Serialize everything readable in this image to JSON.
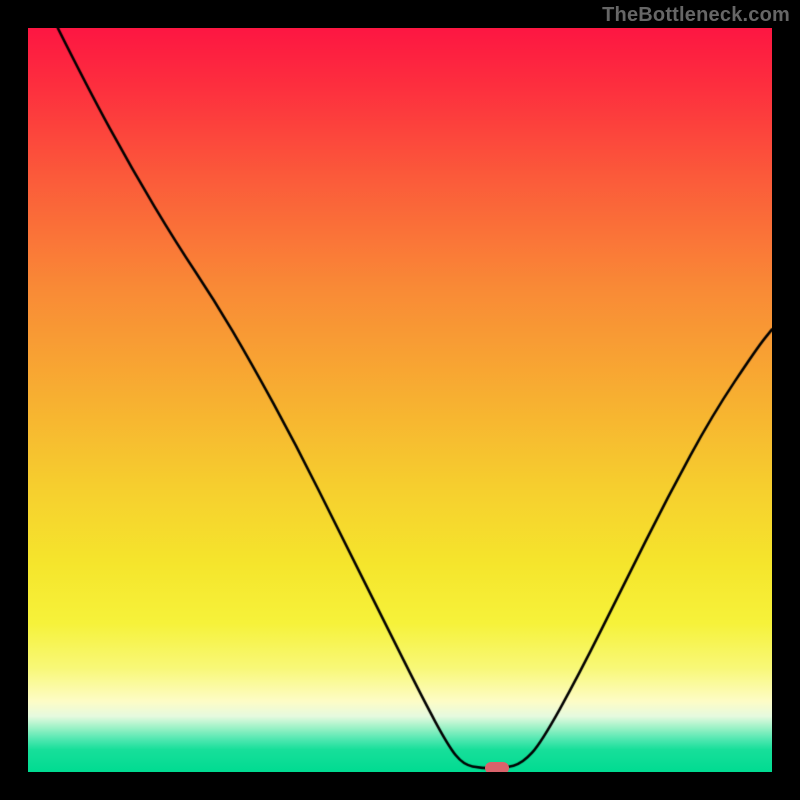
{
  "watermark": "TheBottleneck.com",
  "chart_data": {
    "type": "line",
    "title": "",
    "xlabel": "",
    "ylabel": "",
    "xlim": [
      0,
      100
    ],
    "ylim": [
      0,
      100
    ],
    "grid": false,
    "legend": false,
    "background": {
      "kind": "vertical-gradient",
      "stops": [
        {
          "pos": 0,
          "color": "#fd1642"
        },
        {
          "pos": 8,
          "color": "#fd2f3e"
        },
        {
          "pos": 20,
          "color": "#fb5a3a"
        },
        {
          "pos": 35,
          "color": "#f98a36"
        },
        {
          "pos": 50,
          "color": "#f7b031"
        },
        {
          "pos": 62,
          "color": "#f6cf2e"
        },
        {
          "pos": 72,
          "color": "#f5e52c"
        },
        {
          "pos": 80,
          "color": "#f6f23a"
        },
        {
          "pos": 86,
          "color": "#f8f877"
        },
        {
          "pos": 90.5,
          "color": "#fdfcc6"
        },
        {
          "pos": 92.5,
          "color": "#e6fadf"
        },
        {
          "pos": 94,
          "color": "#9ef2c7"
        },
        {
          "pos": 95.5,
          "color": "#55e8b2"
        },
        {
          "pos": 97,
          "color": "#17df9a"
        },
        {
          "pos": 100,
          "color": "#00db91"
        }
      ]
    },
    "series": [
      {
        "name": "bottleneck-curve",
        "color": "#000000",
        "stroke_width": 2.6,
        "points": [
          {
            "x": 4.0,
            "y": 100.0
          },
          {
            "x": 8.0,
            "y": 92.0
          },
          {
            "x": 14.0,
            "y": 81.0
          },
          {
            "x": 20.0,
            "y": 71.0
          },
          {
            "x": 25.0,
            "y": 63.5
          },
          {
            "x": 30.0,
            "y": 55.0
          },
          {
            "x": 36.0,
            "y": 44.0
          },
          {
            "x": 42.0,
            "y": 32.0
          },
          {
            "x": 48.0,
            "y": 20.0
          },
          {
            "x": 53.0,
            "y": 10.0
          },
          {
            "x": 56.5,
            "y": 3.5
          },
          {
            "x": 58.5,
            "y": 1.0
          },
          {
            "x": 61.0,
            "y": 0.5
          },
          {
            "x": 64.0,
            "y": 0.5
          },
          {
            "x": 66.5,
            "y": 1.2
          },
          {
            "x": 69.0,
            "y": 4.0
          },
          {
            "x": 74.0,
            "y": 13.0
          },
          {
            "x": 80.0,
            "y": 25.0
          },
          {
            "x": 86.0,
            "y": 37.0
          },
          {
            "x": 92.0,
            "y": 48.0
          },
          {
            "x": 98.0,
            "y": 57.0
          },
          {
            "x": 100.0,
            "y": 59.5
          }
        ]
      }
    ],
    "marker": {
      "name": "optimal-point-marker",
      "x": 63.0,
      "y": 0.6,
      "color": "#d9636b",
      "shape": "pill"
    }
  }
}
